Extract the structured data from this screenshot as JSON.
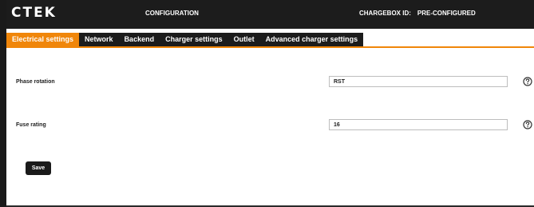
{
  "header": {
    "logo": "CTEK",
    "title": "CONFIGURATION",
    "chargebox_label": "CHARGEBOX ID:",
    "chargebox_value": "PRE-CONFIGURED"
  },
  "tabs": [
    {
      "label": "Electrical settings",
      "active": true
    },
    {
      "label": "Network",
      "active": false
    },
    {
      "label": "Backend",
      "active": false
    },
    {
      "label": "Charger settings",
      "active": false
    },
    {
      "label": "Outlet",
      "active": false
    },
    {
      "label": "Advanced charger settings",
      "active": false
    }
  ],
  "form": {
    "phase_rotation": {
      "label": "Phase rotation",
      "value": "RST"
    },
    "fuse_rating": {
      "label": "Fuse rating",
      "value": "16"
    }
  },
  "actions": {
    "save_label": "Save"
  },
  "colors": {
    "accent": "#f0860a",
    "bar": "#1c1c1c"
  },
  "icons": {
    "help": "help-circle-icon"
  }
}
